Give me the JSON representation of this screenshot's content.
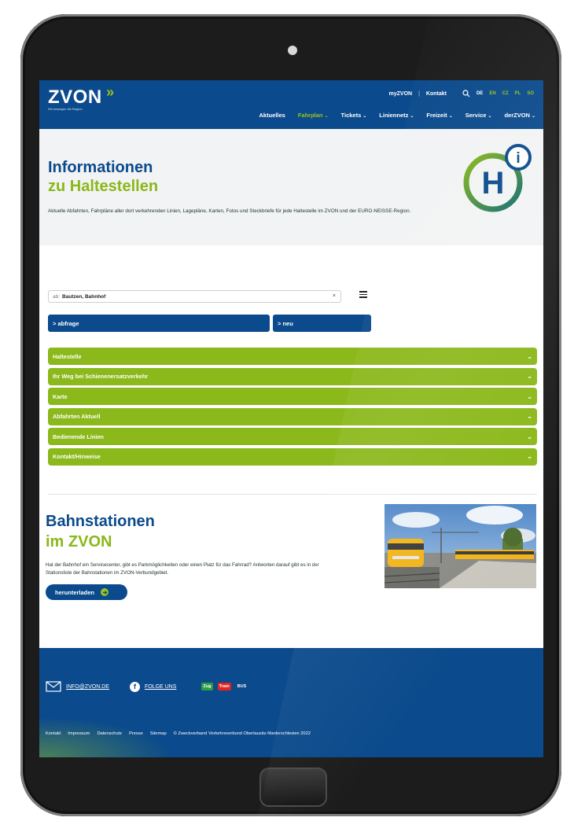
{
  "header": {
    "logo_text": "ZVON",
    "logo_arrows": "»",
    "logo_tagline": "Wir bewegen die Region.",
    "top_links": [
      "myZVON",
      "Kontakt"
    ],
    "separator": "|",
    "languages": [
      "DE",
      "EN",
      "CZ",
      "PL",
      "SO"
    ],
    "nav": [
      {
        "label": "Aktuelles"
      },
      {
        "label": "Fahrplan"
      },
      {
        "label": "Tickets"
      },
      {
        "label": "Liniennetz"
      },
      {
        "label": "Freizeit"
      },
      {
        "label": "Service"
      },
      {
        "label": "derZVON"
      }
    ],
    "chevron": "⌄"
  },
  "hero": {
    "title_line1": "Informationen",
    "title_line2": "zu Haltestellen",
    "description": "Aktuelle Abfahrten, Fahrpläne aller dort verkehrenden Linien, Lagepläne, Karten, Fotos und Steckbriefe für jede Haltestelle im ZVON und der EURO-NEISSE-Region.",
    "icon_letter": "H",
    "icon_info": "i"
  },
  "search": {
    "prefix": "ab:",
    "value": "Bautzen, Bahnhof",
    "clear": "×"
  },
  "buttons": {
    "abfrage": "> abfrage",
    "neu": "> neu"
  },
  "accordion": [
    {
      "label": "Haltestelle"
    },
    {
      "label": "Ihr Weg bei Schienenersatzverkehr"
    },
    {
      "label": "Karte"
    },
    {
      "label": "Abfahrten Aktuell"
    },
    {
      "label": "Bedienende Linien"
    },
    {
      "label": "Kontakt/Hinweise"
    }
  ],
  "accordion_chevron": "⌄",
  "stations": {
    "title_line1": "Bahnstationen",
    "title_line2": "im ZVON",
    "description": "Hat der Bahnhof ein Servicecenter, gibt es Parkmöglichkeiten oder einen Platz für das Fahrrad? Antworten darauf gibt es in der Stationsliste der Bahnstationen im ZVON-Verbundgebiet.",
    "download_label": "herunterladen"
  },
  "footer": {
    "email": "INFO@ZVON.DE",
    "follow": "FOLGE UNS",
    "badges": [
      "Zug",
      "Tram",
      "BUS"
    ],
    "links": [
      "Kontakt",
      "Impressum",
      "Datenschutz",
      "Presse",
      "Sitemap",
      "© Zweckverband Verkehrsverbund Oberlausitz-Niederschlesien 2022"
    ]
  },
  "colors": {
    "brand_blue": "#0b4a8c",
    "brand_green": "#8bb81a",
    "hero_bg": "#f2f3f4"
  }
}
